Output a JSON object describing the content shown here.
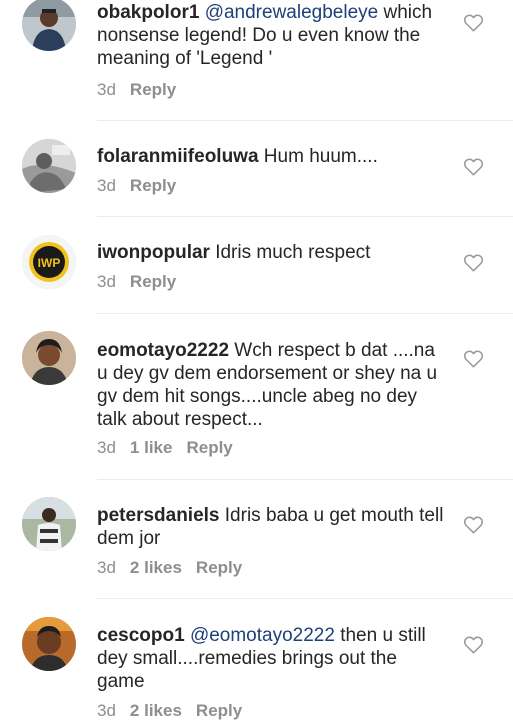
{
  "comments": [
    {
      "username": "obakpolor1",
      "mention": "@andrewalegbeleye",
      "text": " which nonsense legend!  Do u even know the meaning of 'Legend '",
      "time": "3d",
      "likes": "",
      "reply": "Reply"
    },
    {
      "username": "folaranmiifeoluwa",
      "mention": "",
      "text": " Hum huum....",
      "time": "3d",
      "likes": "",
      "reply": "Reply"
    },
    {
      "username": "iwonpopular",
      "mention": "",
      "text": " Idris much respect",
      "time": "3d",
      "likes": "",
      "reply": "Reply"
    },
    {
      "username": "eomotayo2222",
      "mention": "",
      "text": " Wch respect b dat ....na u dey gv dem endorsement or shey na u gv dem hit songs....uncle abeg no dey talk about respect...",
      "time": "3d",
      "likes": "1 like",
      "reply": "Reply"
    },
    {
      "username": "petersdaniels",
      "mention": "",
      "text": " Idris baba u get mouth tell dem jor",
      "time": "3d",
      "likes": "2 likes",
      "reply": "Reply"
    },
    {
      "username": "cescopo1",
      "mention": "@eomotayo2222",
      "text": " then u still dey small....remedies brings out the game",
      "time": "3d",
      "likes": "2 likes",
      "reply": "Reply"
    }
  ],
  "logo_text": "IWP",
  "icons": {
    "like": "heart-outline-icon"
  },
  "colors": {
    "mention": "#1e3f78",
    "meta": "#8e8e8e",
    "text": "#262626"
  }
}
